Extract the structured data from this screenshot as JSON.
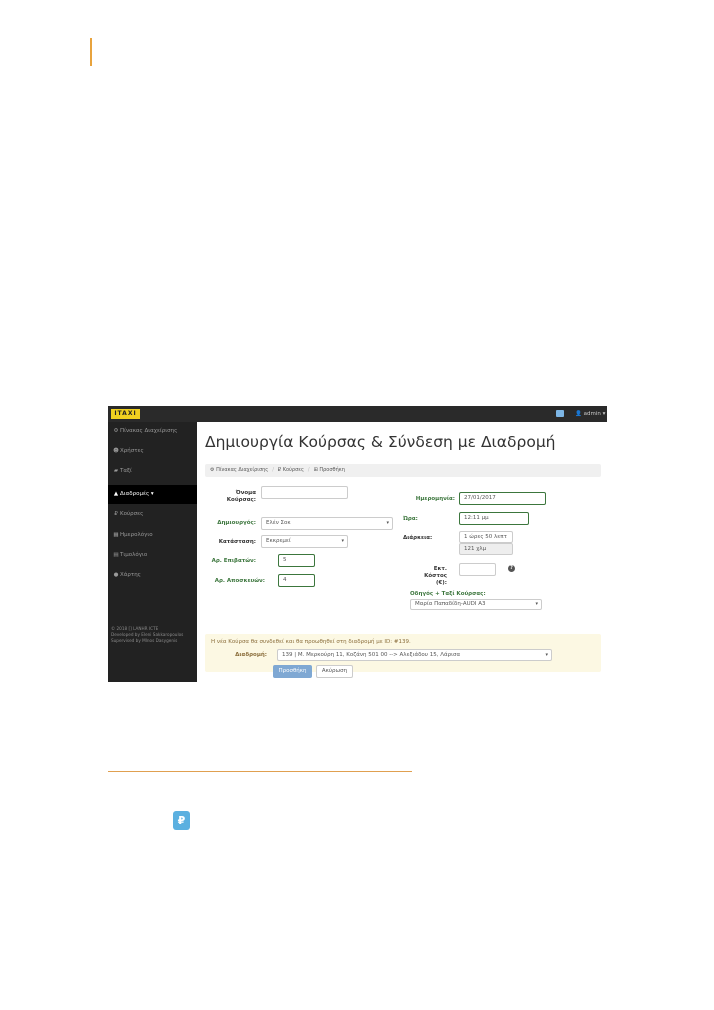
{
  "app": {
    "logo": "ITAXI",
    "user_menu": "admin ▾"
  },
  "sidebar": {
    "items": [
      {
        "icon": "dashboard-icon",
        "glyph": "⚙",
        "label": "Πίνακας Διαχείρισης",
        "active": false
      },
      {
        "icon": "users-icon",
        "glyph": "👥",
        "label": "Χρήστες",
        "active": false
      },
      {
        "icon": "taxi-icon",
        "glyph": "🚗",
        "label": "Ταξί",
        "active": false
      },
      {
        "icon": "road-icon",
        "glyph": "▲",
        "label": "Διαδρομές ▾",
        "active": true
      },
      {
        "icon": "course-icon",
        "glyph": "₽",
        "label": "Κούρσες",
        "active": false
      },
      {
        "icon": "calendar-icon",
        "glyph": "▦",
        "label": "Ημερολόγιο",
        "active": false
      },
      {
        "icon": "pricelist-icon",
        "glyph": "▤",
        "label": "Τιμολόγιο",
        "active": false
      },
      {
        "icon": "map-marker-icon",
        "glyph": "●",
        "label": "Χάρτης",
        "active": false
      }
    ],
    "footer": [
      "© 2018 [] LANHR ICTE",
      "Developed by Eleni Sakkaropoulos",
      "Supervised by Mlnos Dasygenis"
    ]
  },
  "page": {
    "title": "Δημιουργία Κούρσας & Σύνδεση με Διαδρομή",
    "breadcrumb": [
      "Πίνακας Διαχείρισης",
      "Κούρσες",
      "Προσθήκη"
    ]
  },
  "form": {
    "course_name": {
      "label": "Όνομα Κούρσας:",
      "value": ""
    },
    "creator": {
      "label": "Δημιουργός:",
      "value": "Ελέν Σοκ"
    },
    "status": {
      "label": "Κατάσταση:",
      "value": "Εκκρεμεί"
    },
    "passengers": {
      "label": "Αρ. Επιβατών:",
      "value": "5"
    },
    "luggage": {
      "label": "Αρ. Αποσκευών:",
      "value": "4"
    },
    "date": {
      "label": "Ημερομηνία:",
      "value": "27/01/2017"
    },
    "time": {
      "label": "Ώρα:",
      "value": "12:11 μμ"
    },
    "duration": {
      "label": "Διάρκεια:",
      "value": "1 ώρες 50 λεπτ",
      "distance": "121 χλμ"
    },
    "cost": {
      "label": "Εκτ. Κόστος (€):",
      "value": ""
    },
    "driver": {
      "label": "Οδηγός + Ταξί Κούρσας:",
      "value": "Μαρία Παπαδίδη-AUDI A3"
    }
  },
  "alert": {
    "text": "Η νέα Κούρσα θα συνδεθεί και θα προωθηθεί στη διαδρομή με ID: #139.",
    "route_label": "Διαδρομή:",
    "route_value": "139 | Μ. Μερκούρη 11, Κοζάνη 501 00 --> Αλεξιάδου 15, Λάρισα"
  },
  "actions": {
    "submit": "Προσθήκη",
    "cancel": "Ακύρωση"
  },
  "colors": {
    "accent_line": "#e8a33d",
    "logo": "#f0d020",
    "valid_green": "#3c763d",
    "alert_bg": "#fcf8e3",
    "primary": "#7fa8d3"
  },
  "badge": {
    "icon": "course-icon",
    "glyph": "₽"
  }
}
